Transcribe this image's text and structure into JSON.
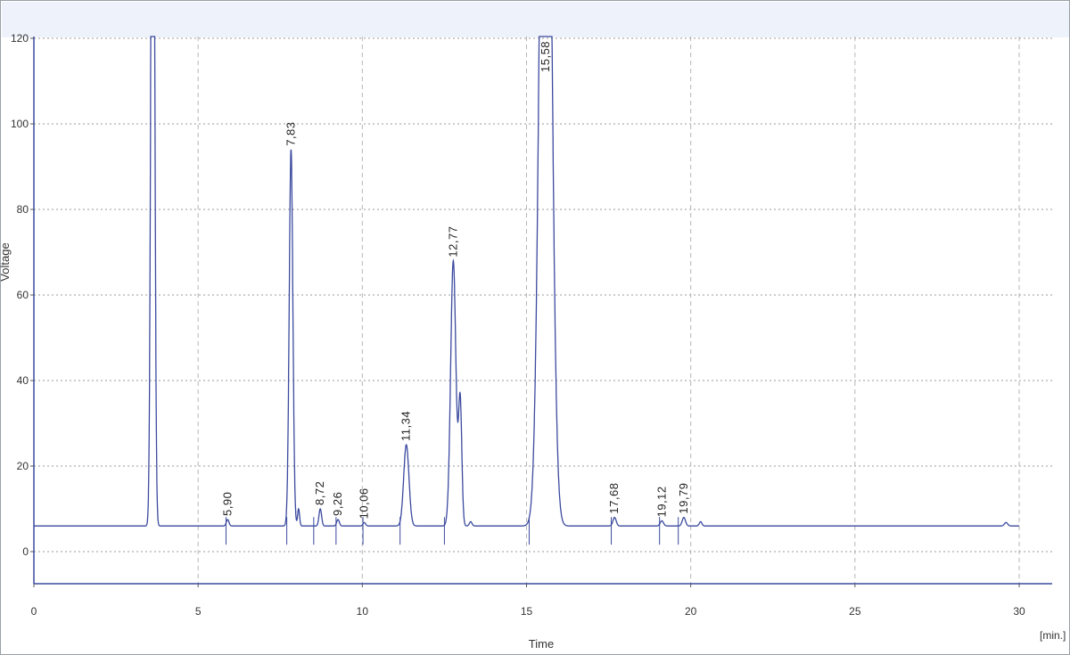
{
  "chart_data": {
    "type": "line",
    "title": "",
    "xlabel": "Time",
    "ylabel": "Voltage",
    "x_unit": "[min.]",
    "xlim": [
      0,
      31
    ],
    "ylim": [
      -7.5,
      120
    ],
    "x_ticks": [
      0,
      5,
      10,
      15,
      20,
      25,
      30
    ],
    "x_tick_labels": [
      "0",
      "5",
      "10",
      "15",
      "20",
      "25",
      "30"
    ],
    "y_ticks": [
      0,
      20,
      40,
      60,
      80,
      100,
      120
    ],
    "y_tick_labels": [
      "0",
      "20",
      "40",
      "60",
      "80",
      "100",
      "120"
    ],
    "grid": true,
    "baseline": 6,
    "trace_end": 30,
    "line_color": "#3b4a9e",
    "peaks": [
      {
        "x": 3.62,
        "y": 250,
        "w": 0.05,
        "label": ""
      },
      {
        "x": 5.9,
        "y": 7.5,
        "w": 0.04,
        "label": "5,90"
      },
      {
        "x": 7.83,
        "y": 94,
        "w": 0.055,
        "label": "7,83"
      },
      {
        "x": 8.06,
        "y": 10,
        "w": 0.03,
        "label": ""
      },
      {
        "x": 8.72,
        "y": 10,
        "w": 0.04,
        "label": "8,72"
      },
      {
        "x": 9.26,
        "y": 7.5,
        "w": 0.04,
        "label": "9,26"
      },
      {
        "x": 10.06,
        "y": 6.8,
        "w": 0.04,
        "label": "10,06"
      },
      {
        "x": 11.34,
        "y": 25,
        "w": 0.08,
        "label": "11,34"
      },
      {
        "x": 12.77,
        "y": 68,
        "w": 0.08,
        "label": "12,77"
      },
      {
        "x": 12.98,
        "y": 35,
        "w": 0.05,
        "label": ""
      },
      {
        "x": 13.3,
        "y": 7,
        "w": 0.04,
        "label": ""
      },
      {
        "x": 15.58,
        "y": 250,
        "w": 0.16,
        "label": "15,58"
      },
      {
        "x": 17.68,
        "y": 8,
        "w": 0.05,
        "label": "17,68"
      },
      {
        "x": 19.12,
        "y": 7.2,
        "w": 0.05,
        "label": "19,12"
      },
      {
        "x": 19.79,
        "y": 8,
        "w": 0.05,
        "label": "19,79"
      },
      {
        "x": 20.3,
        "y": 7,
        "w": 0.04,
        "label": ""
      },
      {
        "x": 29.6,
        "y": 6.8,
        "w": 0.05,
        "label": ""
      }
    ],
    "baseline_markers": [
      5.85,
      7.7,
      8.52,
      9.2,
      10.02,
      11.15,
      12.5,
      15.08,
      17.58,
      19.05,
      19.62
    ]
  }
}
